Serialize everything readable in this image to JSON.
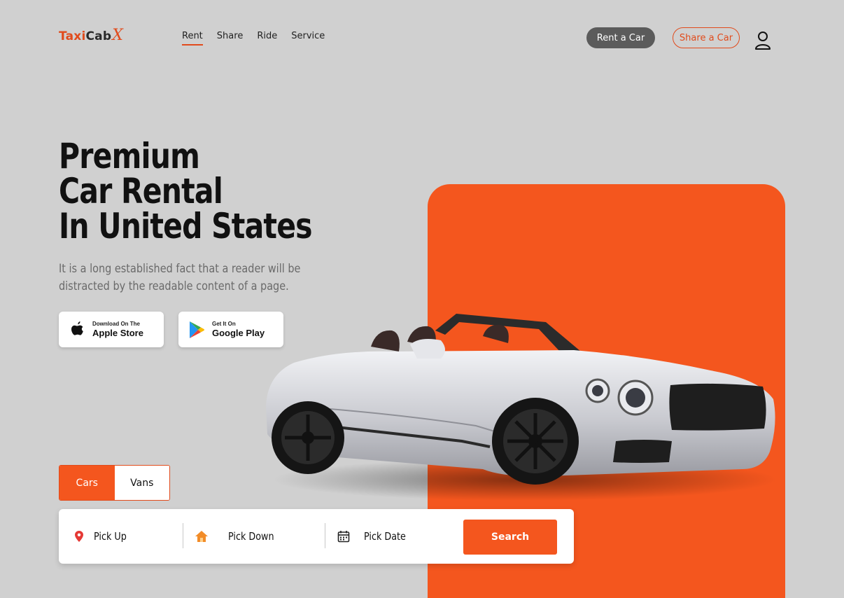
{
  "header": {
    "logo": {
      "part1": "Taxi",
      "part2": "Cab",
      "part3": "X"
    },
    "nav": [
      {
        "label": "Rent",
        "active": true
      },
      {
        "label": "Share",
        "active": false
      },
      {
        "label": "Ride",
        "active": false
      },
      {
        "label": "Service",
        "active": false
      }
    ],
    "rent_button": "Rent a Car",
    "share_button": "Share a Car",
    "user_icon": "user-icon"
  },
  "hero": {
    "headline": [
      "Premium",
      "Car Rental",
      "In United States"
    ],
    "subtext": "It is a long established fact that a reader will be distracted by the readable content of a page.",
    "apple": {
      "small": "Download On The",
      "big": "Apple Store",
      "icon": "apple-icon"
    },
    "google": {
      "small": "Get It On",
      "big": "Google Play",
      "icon": "google-play-icon"
    }
  },
  "booking": {
    "tabs": [
      {
        "label": "Cars",
        "active": true
      },
      {
        "label": "Vans",
        "active": false
      }
    ],
    "pickup": {
      "label": "Pick Up",
      "icon": "location-pin-icon"
    },
    "pickdown": {
      "label": "Pick Down",
      "icon": "home-icon"
    },
    "pickdate": {
      "label": "Pick Date",
      "icon": "calendar-icon"
    },
    "search_button": "Search"
  },
  "colors": {
    "accent": "#f4561e",
    "background": "#d0d0d0",
    "dark_button": "#5b5b5b"
  }
}
